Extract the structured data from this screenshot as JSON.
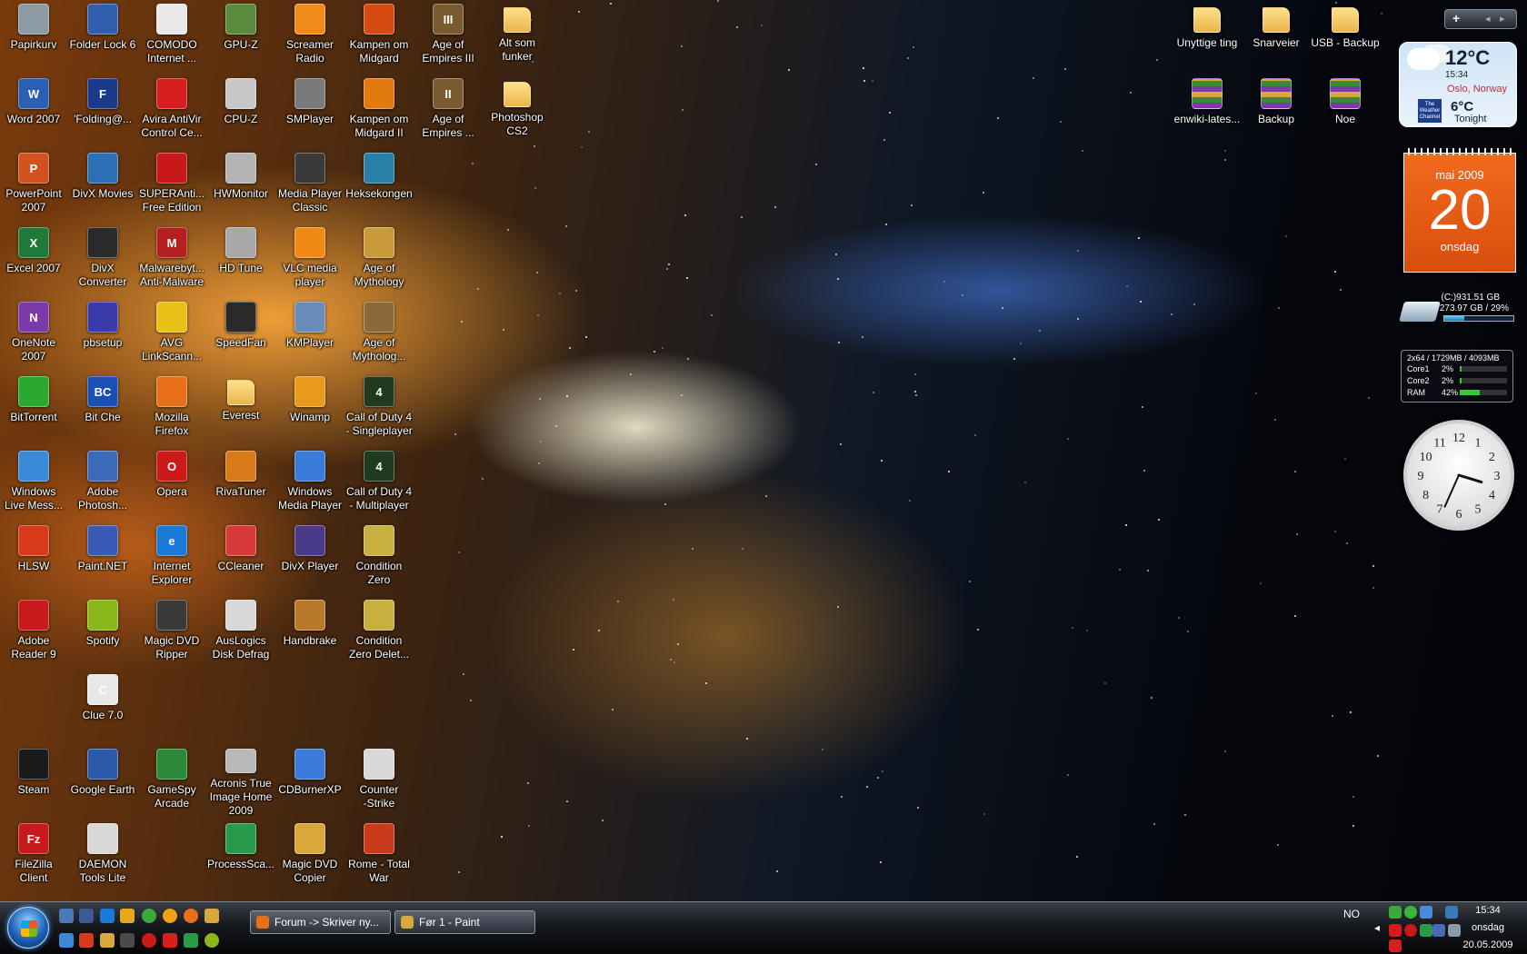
{
  "desktop": {
    "icons": [
      {
        "label": "Papirkurv",
        "glyph": "",
        "color": "#8c9aa6"
      },
      {
        "label": "Folder Lock 6",
        "glyph": "",
        "color": "#2f5fae"
      },
      {
        "label": "COMODO\nInternet ...",
        "glyph": "",
        "color": "#e9e9e9"
      },
      {
        "label": "GPU-Z",
        "glyph": "",
        "color": "#5a8a3c"
      },
      {
        "label": "Screamer\nRadio",
        "glyph": "",
        "color": "#f28a1a"
      },
      {
        "label": "Kampen om\nMidgard",
        "glyph": "",
        "color": "#d44a10"
      },
      {
        "label": "Age of\nEmpires III",
        "glyph": "III",
        "color": "#7a5a30"
      },
      {
        "label": "Alt som\nfunker",
        "glyph": "",
        "color": "folder"
      },
      {
        "label": "Word 2007",
        "glyph": "W",
        "color": "#2b5fb4"
      },
      {
        "label": "'Folding@...",
        "glyph": "F",
        "color": "#1a3b8a"
      },
      {
        "label": "Avira AntiVir\nControl Ce...",
        "glyph": "",
        "color": "#d81e1e"
      },
      {
        "label": "CPU-Z",
        "glyph": "",
        "color": "#c8c8c8"
      },
      {
        "label": "SMPlayer",
        "glyph": "",
        "color": "#7a7a7a"
      },
      {
        "label": "Kampen om\nMidgard II",
        "glyph": "",
        "color": "#e27a10"
      },
      {
        "label": "Age of\nEmpires ...",
        "glyph": "II",
        "color": "#7a5a30"
      },
      {
        "label": "Photoshop\nCS2",
        "glyph": "",
        "color": "folder"
      },
      {
        "label": "PowerPoint\n2007",
        "glyph": "P",
        "color": "#d2521f"
      },
      {
        "label": "DivX Movies",
        "glyph": "",
        "color": "#2b6fb4"
      },
      {
        "label": "SUPERAnti...\nFree Edition",
        "glyph": "",
        "color": "#c81818"
      },
      {
        "label": "HWMonitor",
        "glyph": "",
        "color": "#b4b4b4"
      },
      {
        "label": "Media Player\nClassic",
        "glyph": "",
        "color": "#3a3a3a"
      },
      {
        "label": "Heksekongen",
        "glyph": "",
        "color": "#2a7fa8"
      },
      {
        "label": "Excel 2007",
        "glyph": "X",
        "color": "#1f7a3a"
      },
      {
        "label": "DivX\nConverter",
        "glyph": "",
        "color": "#2a2a2a"
      },
      {
        "label": "Malwarebyt...\nAnti-Malware",
        "glyph": "M",
        "color": "#b42020"
      },
      {
        "label": "HD Tune",
        "glyph": "",
        "color": "#a8a8a8"
      },
      {
        "label": "VLC media\nplayer",
        "glyph": "",
        "color": "#f08a14"
      },
      {
        "label": "Age of\nMythology",
        "glyph": "",
        "color": "#c89a3a"
      },
      {
        "label": "OneNote\n2007",
        "glyph": "N",
        "color": "#7a3aa8"
      },
      {
        "label": "pbsetup",
        "glyph": "",
        "color": "#3a3aa8"
      },
      {
        "label": "AVG\nLinkScann...",
        "glyph": "",
        "color": "#e8c018"
      },
      {
        "label": "SpeedFan",
        "glyph": "",
        "color": "#2a2a2a"
      },
      {
        "label": "KMPlayer",
        "glyph": "",
        "color": "#6a8ab8"
      },
      {
        "label": "Age of\nMytholog...",
        "glyph": "",
        "color": "#8a6a3a"
      },
      {
        "label": "BitTorrent",
        "glyph": "",
        "color": "#2aa830"
      },
      {
        "label": "Bit Che",
        "glyph": "BC",
        "color": "#1a4fb4"
      },
      {
        "label": "Mozilla\nFirefox",
        "glyph": "",
        "color": "#e8701a"
      },
      {
        "label": "Everest",
        "glyph": "",
        "color": "folder"
      },
      {
        "label": "Winamp",
        "glyph": "",
        "color": "#e89a1a"
      },
      {
        "label": "Call of Duty 4\n- Singleplayer",
        "glyph": "4",
        "color": "#1f3a1f"
      },
      {
        "label": "Windows\nLive Mess...",
        "glyph": "",
        "color": "#3a8ad8"
      },
      {
        "label": "Adobe\nPhotosh...",
        "glyph": "",
        "color": "#3a6ab8"
      },
      {
        "label": "Opera",
        "glyph": "O",
        "color": "#cc1a1a"
      },
      {
        "label": "RivaTuner",
        "glyph": "",
        "color": "#d87a1a"
      },
      {
        "label": "Windows\nMedia Player",
        "glyph": "",
        "color": "#3a7ad8"
      },
      {
        "label": "Call of Duty 4\n- Multiplayer",
        "glyph": "4",
        "color": "#1f3a1f"
      },
      {
        "label": "HLSW",
        "glyph": "",
        "color": "#d83a1a"
      },
      {
        "label": "Paint.NET",
        "glyph": "",
        "color": "#3a5ab8"
      },
      {
        "label": "Internet\nExplorer",
        "glyph": "e",
        "color": "#1a7ad8"
      },
      {
        "label": "CCleaner",
        "glyph": "",
        "color": "#d83a3a"
      },
      {
        "label": "DivX Player",
        "glyph": "",
        "color": "#4a3a8a"
      },
      {
        "label": "Condition\nZero",
        "glyph": "",
        "color": "#c8b040"
      },
      {
        "label": "Adobe\nReader 9",
        "glyph": "",
        "color": "#c81a1a"
      },
      {
        "label": "Spotify",
        "glyph": "",
        "color": "#8ab81a"
      },
      {
        "label": "Magic DVD\nRipper",
        "glyph": "",
        "color": "#3a3a3a"
      },
      {
        "label": "AusLogics\nDisk Defrag",
        "glyph": "",
        "color": "#d8d8d8"
      },
      {
        "label": "Handbrake",
        "glyph": "",
        "color": "#b87a2a"
      },
      {
        "label": "Condition\nZero Delet...",
        "glyph": "",
        "color": "#c8b040"
      },
      {
        "label": "Clue 7.0",
        "glyph": "C",
        "color": "#e8e8e8"
      },
      {
        "label": "Steam",
        "glyph": "",
        "color": "#1a1a1a"
      },
      {
        "label": "Google Earth",
        "glyph": "",
        "color": "#2a5aa8"
      },
      {
        "label": "GameSpy\nArcade",
        "glyph": "",
        "color": "#2a8a3a"
      },
      {
        "label": "Acronis True\nImage Home\n2009",
        "glyph": "",
        "color": "#b8b8b8"
      },
      {
        "label": "CDBurnerXP",
        "glyph": "",
        "color": "#3a7ad8"
      },
      {
        "label": "Counter\n-Strike",
        "glyph": "",
        "color": "#d8d8d8"
      },
      {
        "label": "FileZilla\nClient",
        "glyph": "Fz",
        "color": "#c81a1a"
      },
      {
        "label": "DAEMON\nTools Lite",
        "glyph": "",
        "color": "#d8d8d8"
      },
      {
        "label": "ProcessSca...",
        "glyph": "",
        "color": "#2a9a4a"
      },
      {
        "label": "Magic DVD\nCopier",
        "glyph": "",
        "color": "#d8a83a"
      },
      {
        "label": "Rome - Total\nWar",
        "glyph": "",
        "color": "#c83a1a"
      }
    ],
    "right_icons": [
      {
        "label": "Unyttige ting",
        "color": "folder"
      },
      {
        "label": "Snarveier",
        "color": "folder"
      },
      {
        "label": "USB - Backup",
        "color": "folder"
      },
      {
        "label": "enwiki-lates...",
        "color": "#7a3aa8"
      },
      {
        "label": "Backup",
        "color": "#7a3aa8"
      },
      {
        "label": "Noe",
        "color": "#7a3aa8"
      }
    ]
  },
  "gadgets": {
    "sidebar_buttons": {
      "add": "+",
      "prev": "◂",
      "next": "▸"
    },
    "weather": {
      "temp": "12°C",
      "time": "15:34",
      "location": "Oslo, Norway",
      "logo": "The Weather Channel",
      "low": "6°C",
      "tonight": "Tonight"
    },
    "calendar": {
      "month": "mai 2009",
      "day": "20",
      "weekday": "onsdag"
    },
    "drive": {
      "line1": "(C:)931.51 GB",
      "line2": "273.97 GB / 29%",
      "used_fraction": 0.29
    },
    "cpu": {
      "header": "2x64 / 1729MB / 4093MB",
      "rows": [
        {
          "name": "Core1",
          "pct": "2%",
          "value": 0.02
        },
        {
          "name": "Core2",
          "pct": "2%",
          "value": 0.02
        },
        {
          "name": "RAM",
          "pct": "42%",
          "value": 0.42
        }
      ]
    },
    "clock": {
      "hour": 3,
      "minute": 34
    }
  },
  "taskbar": {
    "buttons": [
      {
        "label": "Forum -> Skriver ny...",
        "color": "#e8701a"
      },
      {
        "label": "Før 1 - Paint",
        "color": "#d8a83a"
      }
    ],
    "language": "NO",
    "tray_arrow": "◂",
    "clock": {
      "time": "15:34",
      "day": "onsdag",
      "date": "20.05.2009"
    }
  }
}
